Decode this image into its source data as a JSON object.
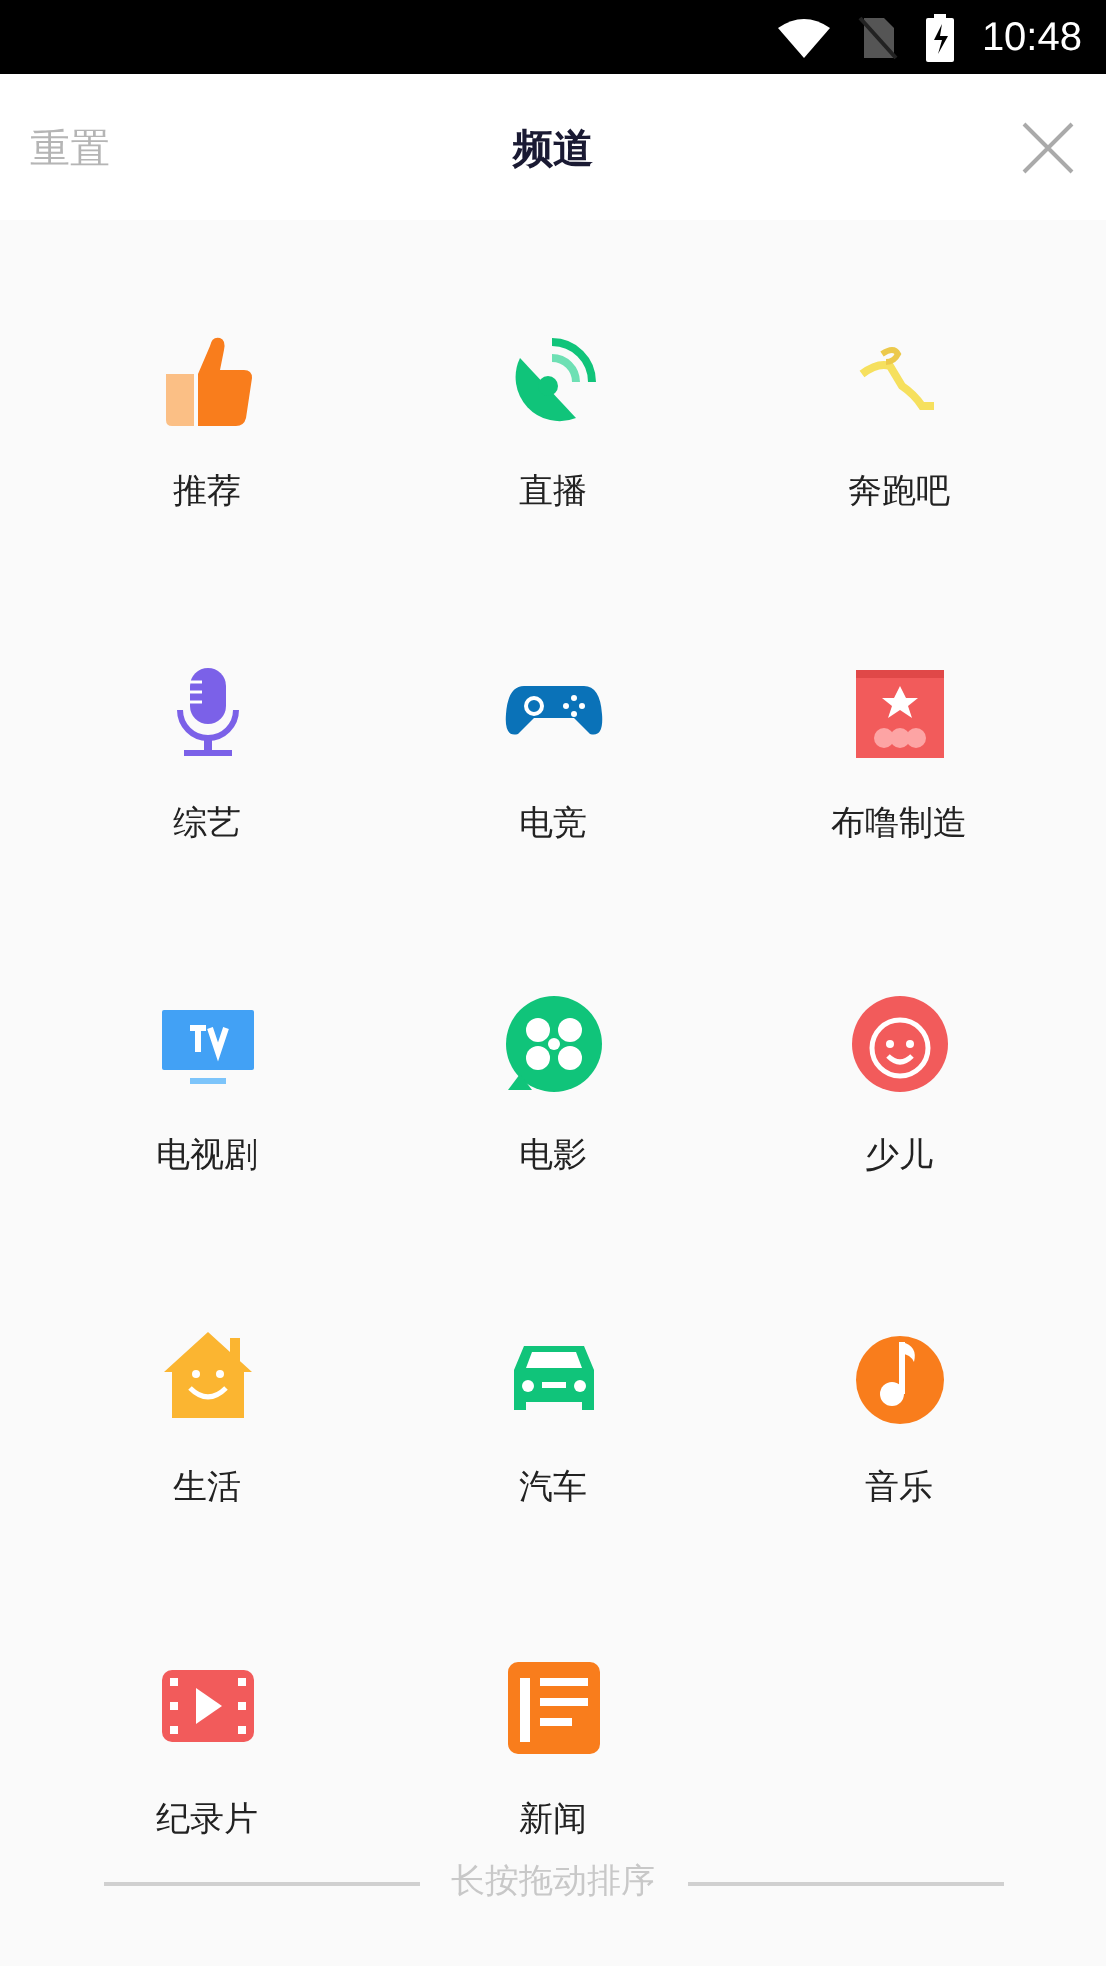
{
  "status_bar": {
    "time": "10:48"
  },
  "header": {
    "reset": "重置",
    "title": "频道"
  },
  "channels": [
    {
      "label": "推荐"
    },
    {
      "label": "直播"
    },
    {
      "label": "奔跑吧"
    },
    {
      "label": "综艺"
    },
    {
      "label": "电竞"
    },
    {
      "label": "布噜制造"
    },
    {
      "label": "电视剧"
    },
    {
      "label": "电影"
    },
    {
      "label": "少儿"
    },
    {
      "label": "生活"
    },
    {
      "label": "汽车"
    },
    {
      "label": "音乐"
    },
    {
      "label": "纪录片"
    },
    {
      "label": "新闻"
    }
  ],
  "footer": {
    "hint": "长按拖动排序"
  }
}
